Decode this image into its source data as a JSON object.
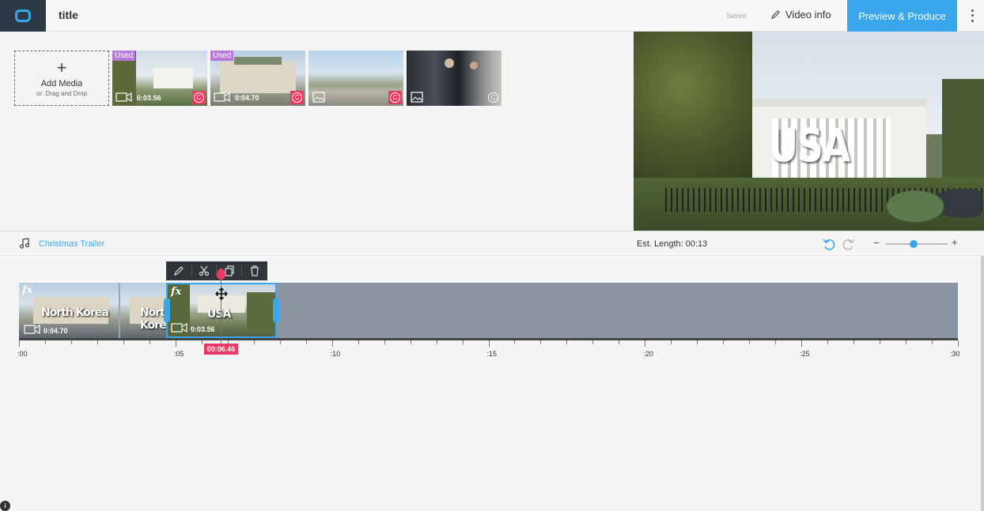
{
  "header": {
    "title": "title",
    "saved_status": "Saved",
    "video_info_label": "Video info",
    "preview_button_label": "Preview & Produce"
  },
  "media": {
    "add_label": "Add Media",
    "add_sub": "or: Drag and Drop",
    "items": [
      {
        "used_label": "Used",
        "duration": "0:03.56",
        "kind": "video-icon"
      },
      {
        "used_label": "Used",
        "duration": "0:04.70",
        "kind": "video-icon"
      },
      {
        "used_label": "",
        "duration": "",
        "kind": "image-icon"
      },
      {
        "used_label": "",
        "duration": "",
        "kind": "image-icon"
      }
    ],
    "copyright_symbol": "C"
  },
  "preview": {
    "caption": "USA"
  },
  "music": {
    "track_name": "Christmas Trailer"
  },
  "timeline": {
    "est_length": "Est. Length: 00:13",
    "zoom_minus": "−",
    "zoom_plus": "+",
    "zoom_level": 0.45,
    "playhead_time": "00:06.46",
    "fx_label": "fx",
    "clips": [
      {
        "caption": "North Korea",
        "duration": "0:04.70"
      },
      {
        "caption": "USA",
        "duration": "0:03.56"
      }
    ],
    "tick_labels": [
      ":00",
      ":05",
      ":10",
      ":15",
      ":20",
      ":25",
      ":30"
    ]
  },
  "colors": {
    "accent": "#3aa6ec",
    "playhead": "#e83a62",
    "used_badge": "#b57ad9"
  }
}
